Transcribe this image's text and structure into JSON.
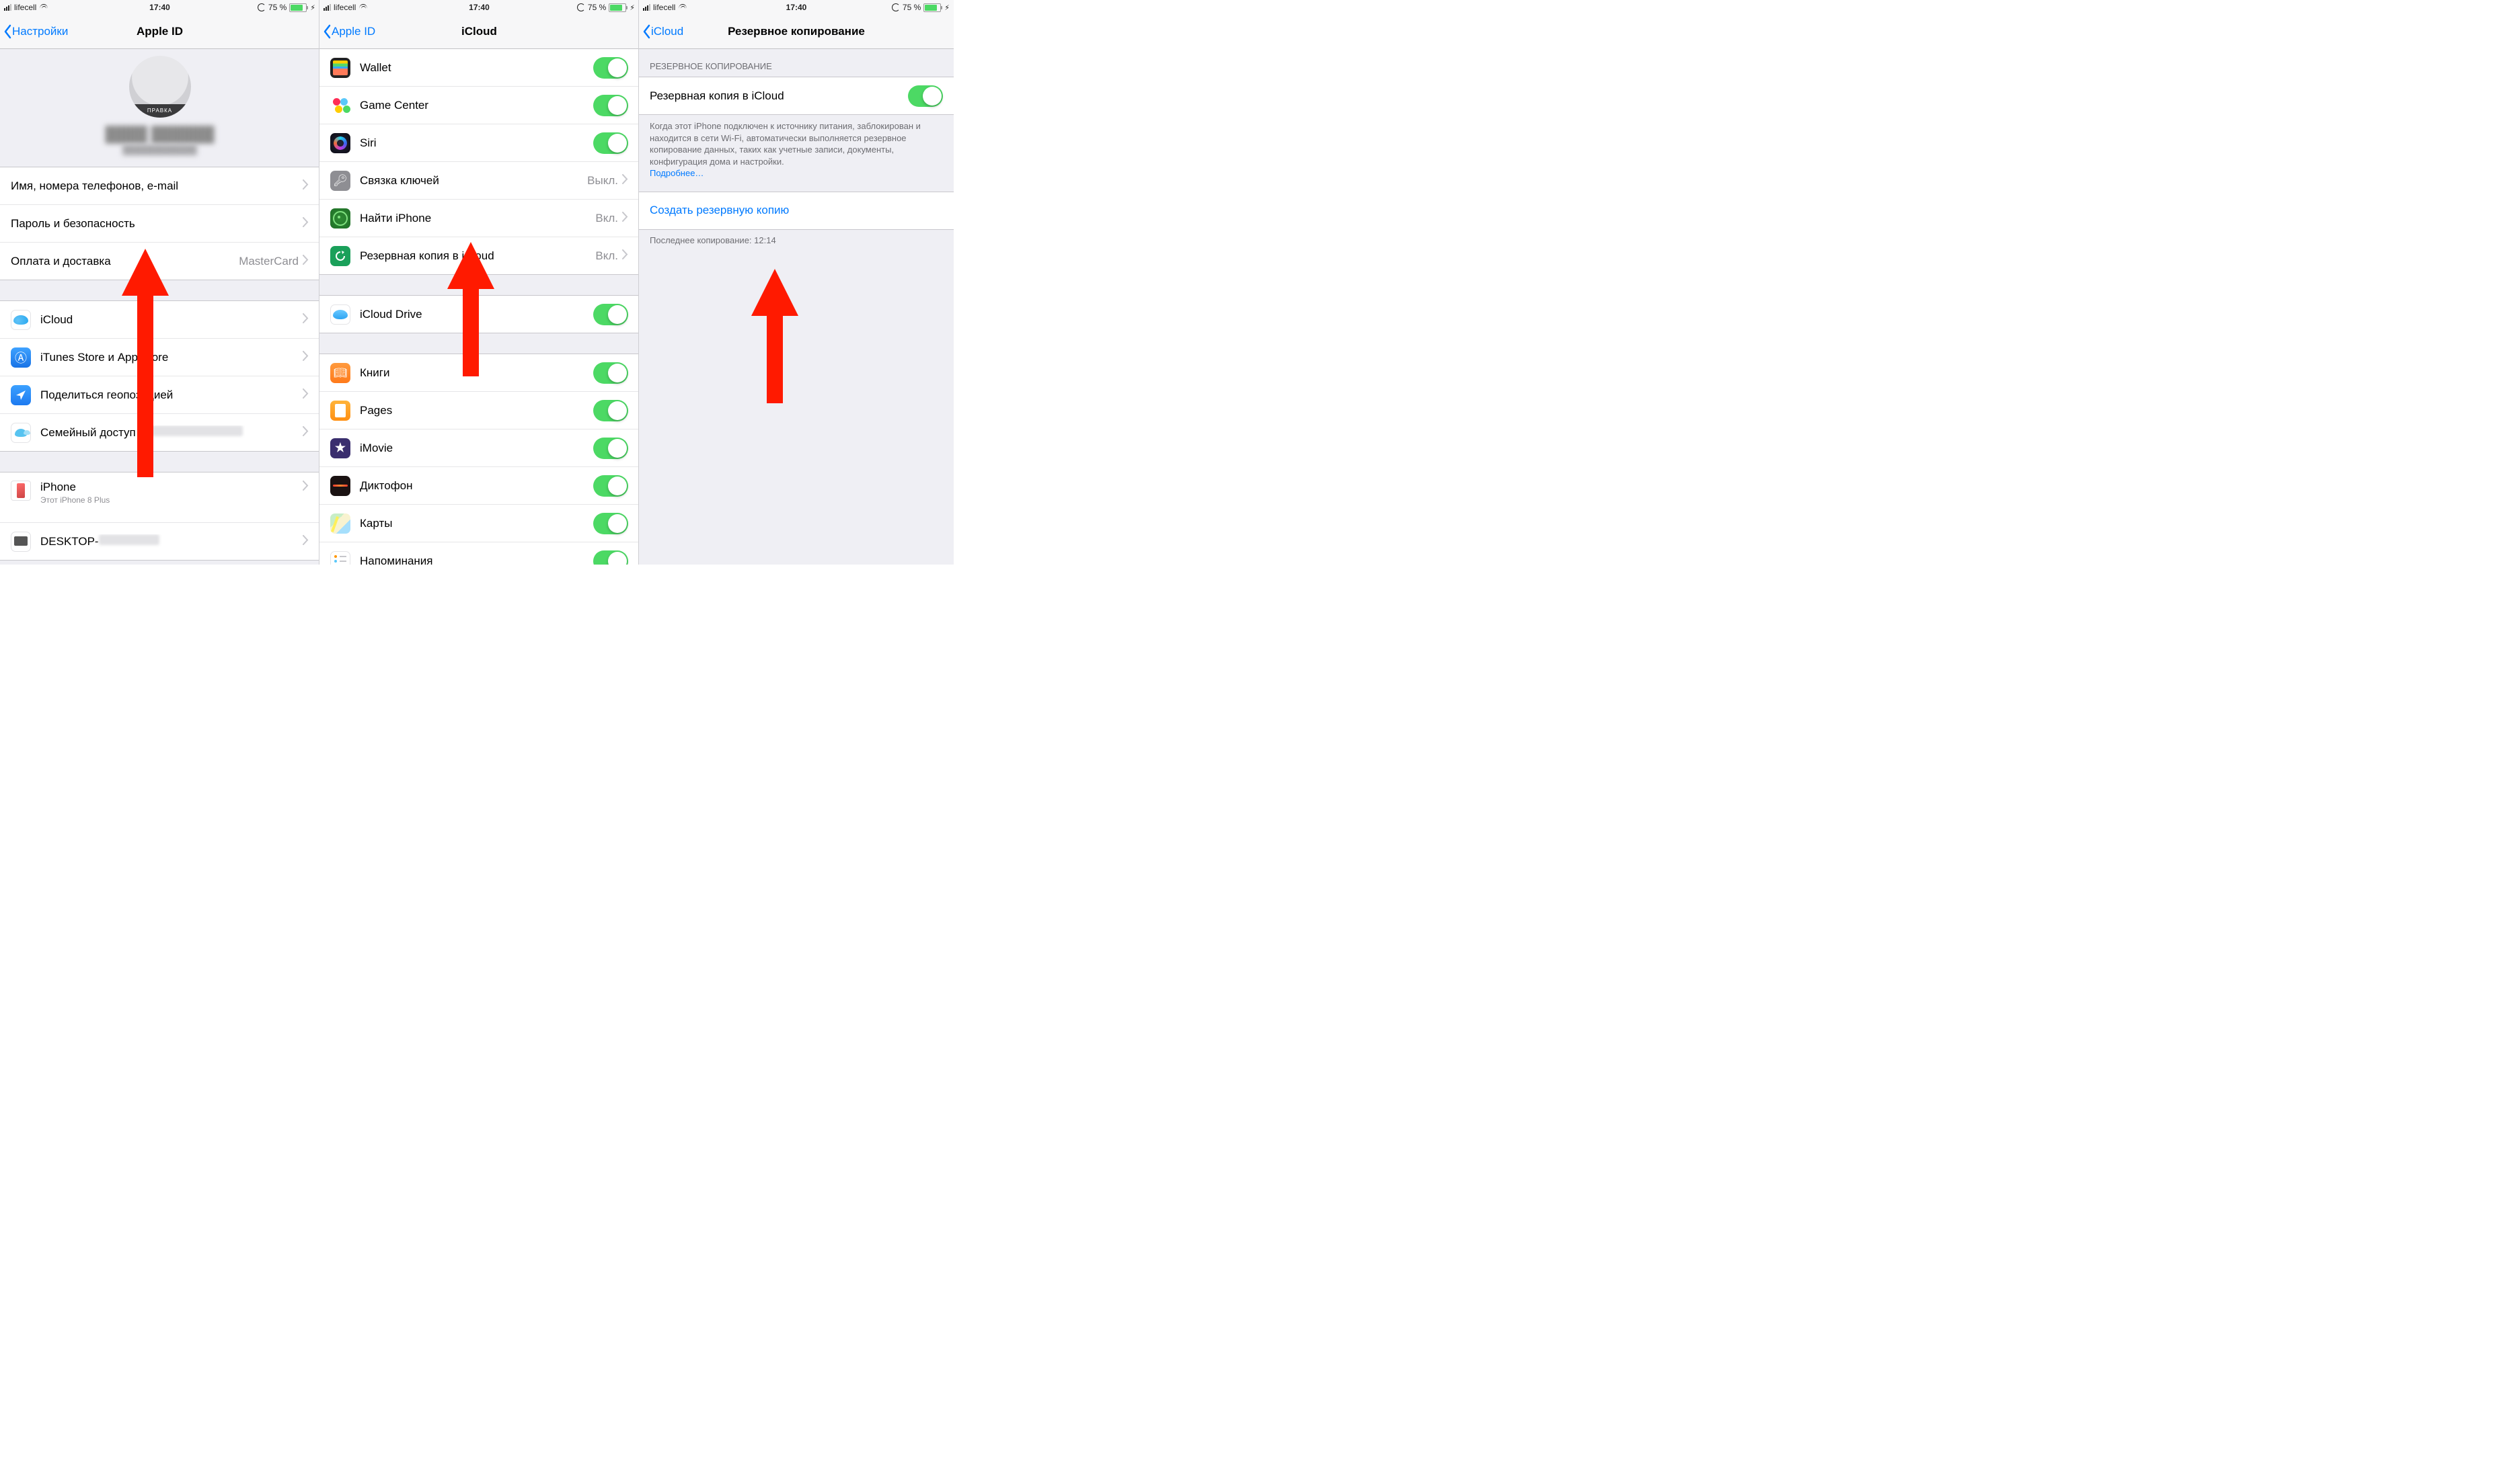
{
  "status": {
    "carrier": "lifecell",
    "time": "17:40",
    "battery_pct": "75 %"
  },
  "screen0": {
    "back": "Настройки",
    "title": "Apple ID",
    "avatar_badge": "ПРАВКА",
    "rows_account": [
      {
        "label": "Имя, номера телефонов, e-mail"
      },
      {
        "label": "Пароль и безопасность"
      },
      {
        "label": "Оплата и доставка",
        "detail": "MasterCard"
      }
    ],
    "rows_services": [
      {
        "label": "iCloud"
      },
      {
        "label": "iTunes Store и App Store"
      },
      {
        "label": "Поделиться геопозицией"
      },
      {
        "label": "Семейный доступ"
      }
    ],
    "rows_devices": [
      {
        "label": "iPhone",
        "sub": "Этот iPhone 8 Plus"
      },
      {
        "label": "DESKTOP-"
      }
    ]
  },
  "screen1": {
    "back": "Apple ID",
    "title": "iCloud",
    "rows": [
      {
        "id": "wallet",
        "label": "Wallet",
        "toggle": true
      },
      {
        "id": "gc",
        "label": "Game Center",
        "toggle": true
      },
      {
        "id": "siri",
        "label": "Siri",
        "toggle": true
      },
      {
        "id": "keychain",
        "label": "Связка ключей",
        "detail": "Выкл."
      },
      {
        "id": "find",
        "label": "Найти iPhone",
        "detail": "Вкл."
      },
      {
        "id": "backup",
        "label": "Резервная копия в iCloud",
        "detail": "Вкл."
      }
    ],
    "rows2": [
      {
        "id": "drive",
        "label": "iCloud Drive",
        "toggle": true
      }
    ],
    "rows3": [
      {
        "id": "books",
        "label": "Книги",
        "toggle": true
      },
      {
        "id": "pages",
        "label": "Pages",
        "toggle": true
      },
      {
        "id": "imovie",
        "label": "iMovie",
        "toggle": true
      },
      {
        "id": "voice",
        "label": "Диктофон",
        "toggle": true
      },
      {
        "id": "maps",
        "label": "Карты",
        "toggle": true
      },
      {
        "id": "reminders",
        "label": "Напоминания",
        "toggle": true
      }
    ]
  },
  "screen2": {
    "back": "iCloud",
    "title": "Резервное копирование",
    "section_header": "РЕЗЕРВНОЕ КОПИРОВАНИЕ",
    "toggle_label": "Резервная копия в iCloud",
    "footer_text": "Когда этот iPhone подключен к источнику питания, заблокирован и находится в сети Wi-Fi, автоматически выполняется резервное копирование данных, таких как учетные записи, документы, конфигурация дома и настройки.",
    "learn_more": "Подробнее…",
    "backup_now": "Создать резервную копию",
    "last_backup": "Последнее копирование: 12:14"
  }
}
